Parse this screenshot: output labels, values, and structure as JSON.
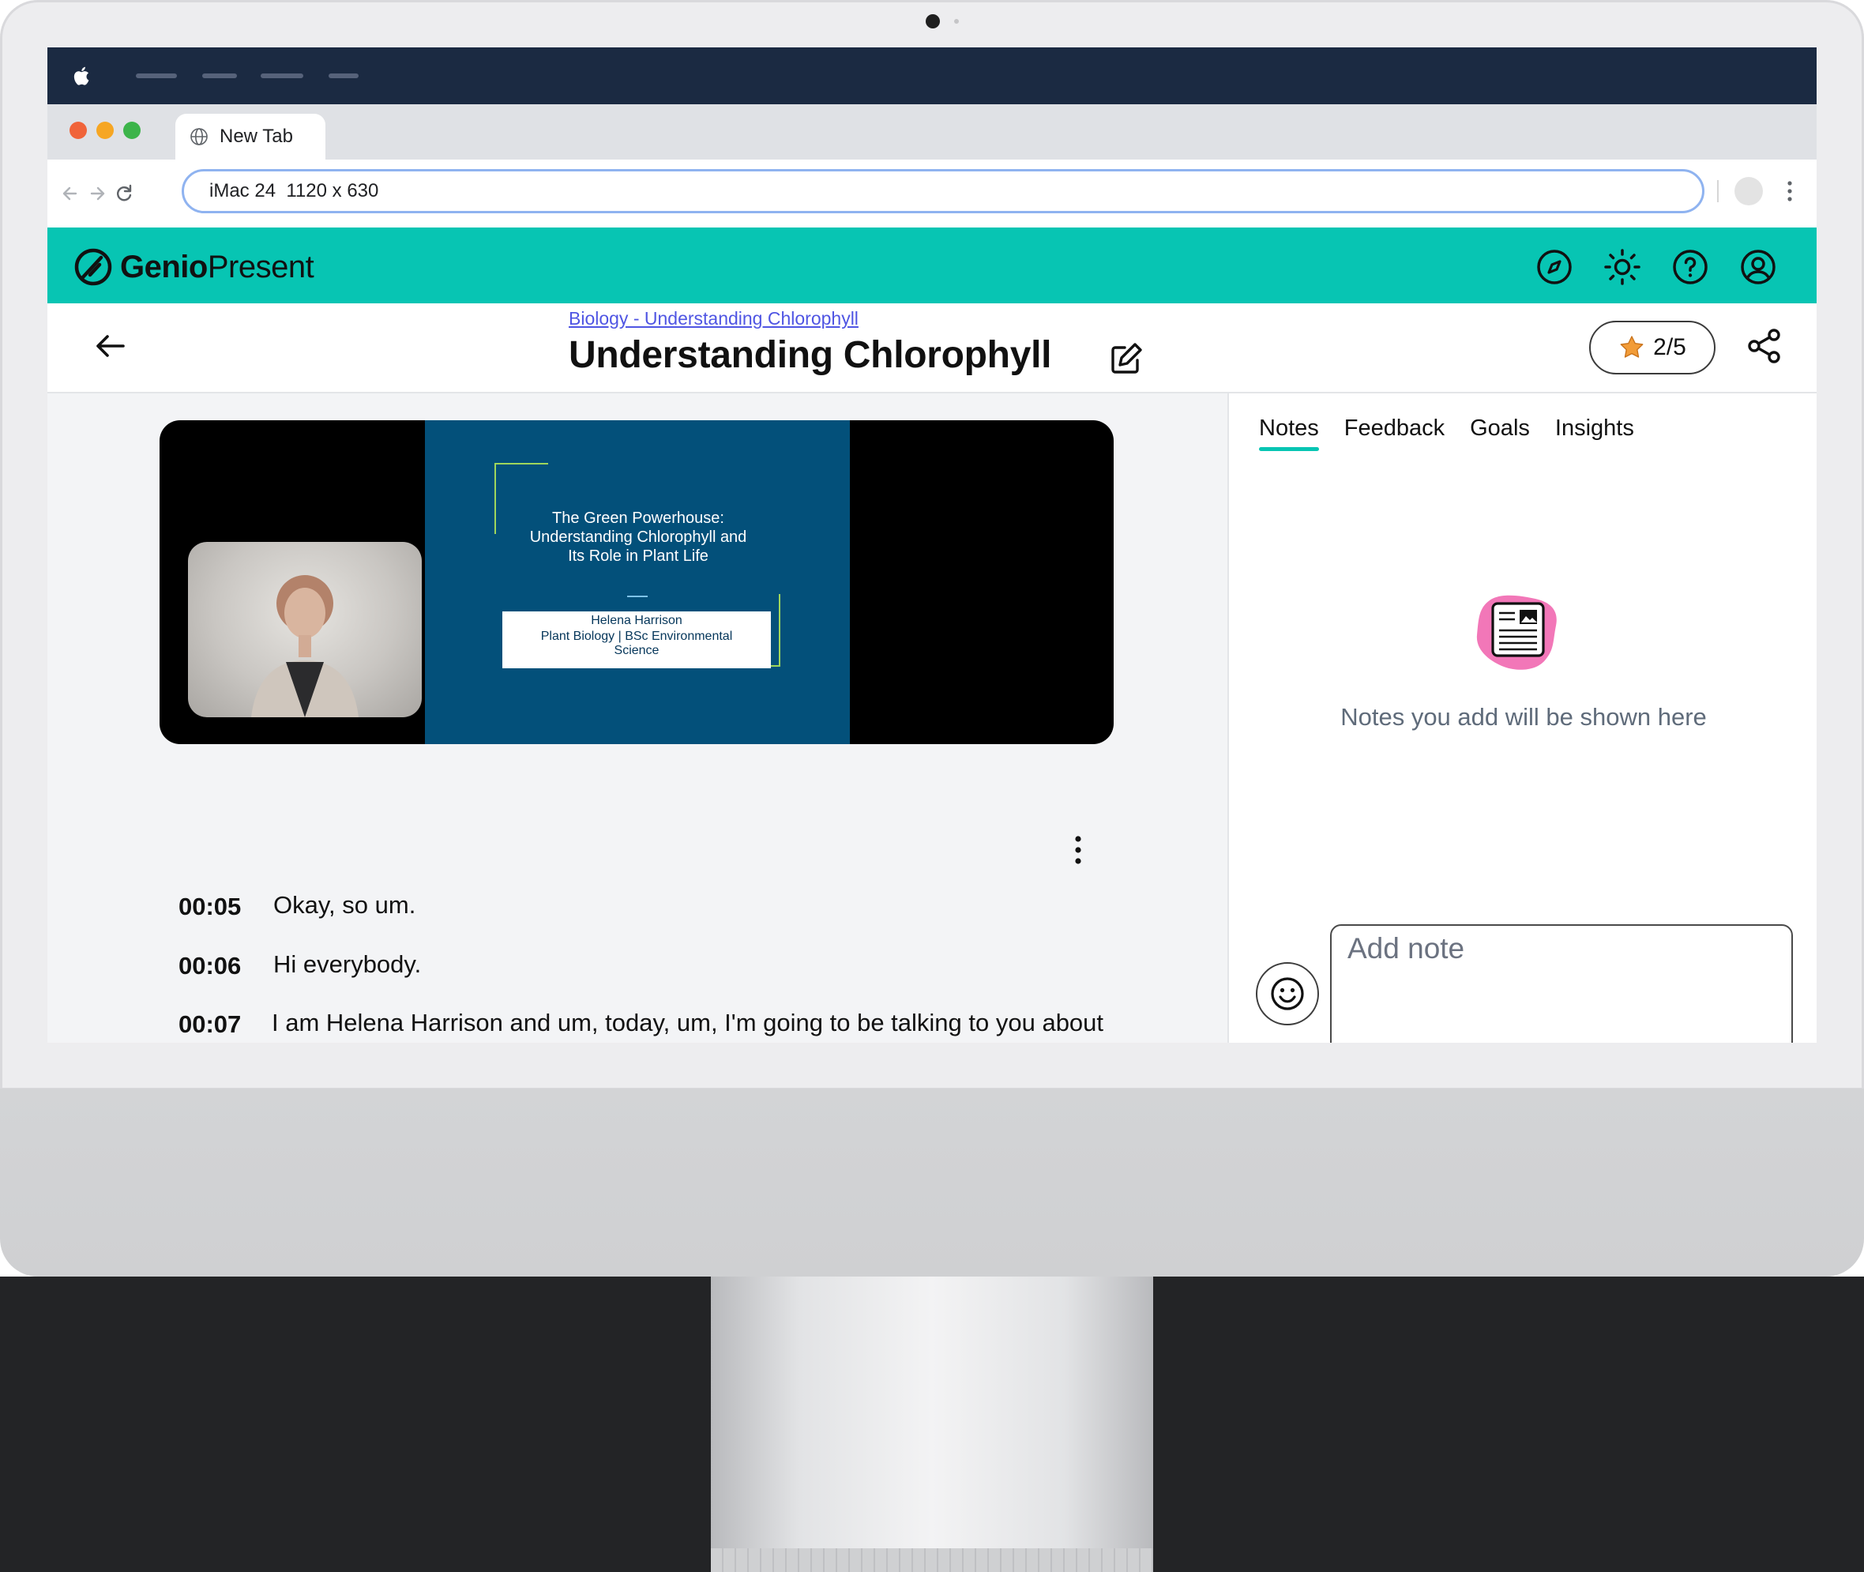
{
  "browser": {
    "tab_title": "New Tab",
    "address": "iMac 24  1120 x 630"
  },
  "app": {
    "brand_bold": "Genio",
    "brand_light": "Present",
    "accent_color": "#07c5b3",
    "header_icons": [
      "compass-icon",
      "sun-icon",
      "help-icon",
      "user-icon"
    ]
  },
  "titlebar": {
    "breadcrumb": "Biology - Understanding Chlorophyll",
    "title": "Understanding Chlorophyll",
    "rating": "2/5"
  },
  "slide": {
    "title_lines": [
      "The Green Powerhouse:",
      "Understanding Chlorophyll and",
      "Its Role in Plant Life"
    ],
    "presenter": "Helena Harrison",
    "subtitle_lines": [
      "Plant Biology | BSc Environmental",
      "Science"
    ]
  },
  "transcript": [
    {
      "time": "00:05",
      "text": "Okay, so um."
    },
    {
      "time": "00:06",
      "text": "Hi everybody."
    },
    {
      "time": "00:07",
      "text": "I am Helena Harrison and um, today, um, I'm going to be talking to you about chlorophyll, which is, you know, the molecule that gives plants"
    }
  ],
  "right_panel": {
    "tabs": [
      "Notes",
      "Feedback",
      "Goals",
      "Insights"
    ],
    "active_tab": "Notes",
    "empty_message": "Notes you add will be shown here",
    "note_placeholder": "Add note"
  }
}
